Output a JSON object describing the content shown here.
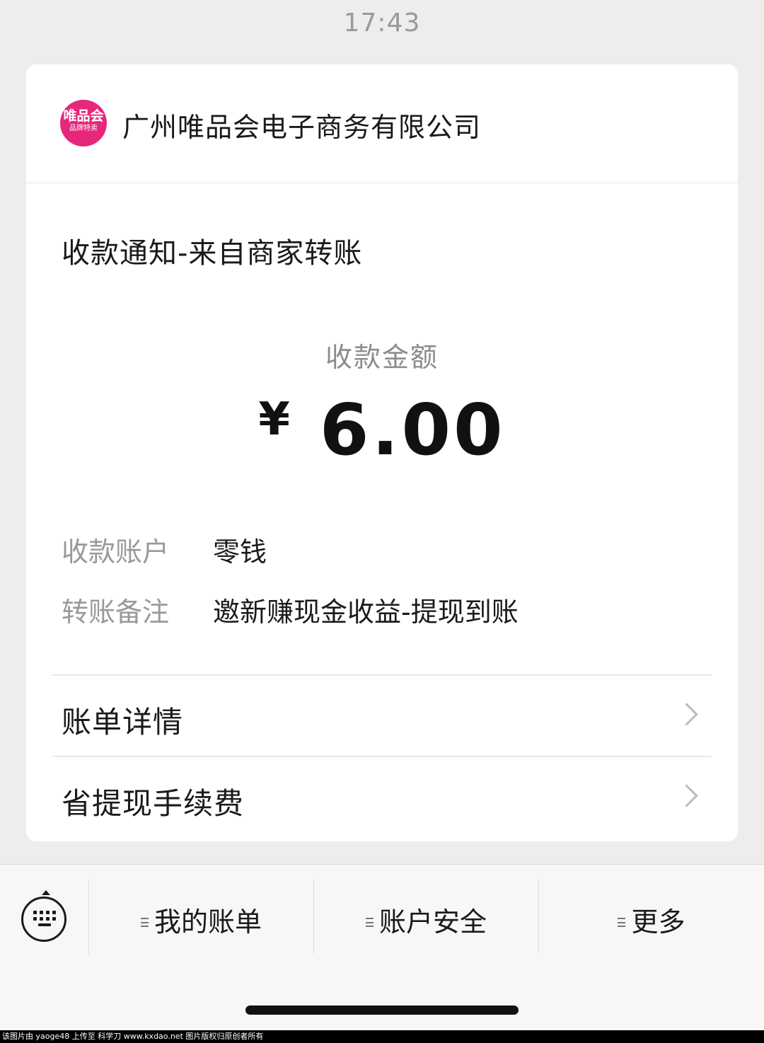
{
  "status_bar": {
    "time": "17:43"
  },
  "merchant": {
    "logo_text": "唯品会",
    "logo_subtext": "品牌特卖",
    "name": "广州唯品会电子商务有限公司"
  },
  "notice": {
    "title": "收款通知-来自商家转账",
    "amount_label": "收款金额",
    "currency_symbol": "¥",
    "amount": "6.00",
    "details": [
      {
        "label": "收款账户",
        "value": "零钱"
      },
      {
        "label": "转账备注",
        "value": "邀新赚现金收益-提现到账"
      }
    ]
  },
  "menu": [
    {
      "label": "账单详情"
    },
    {
      "label": "省提现手续费"
    }
  ],
  "bottom_bar": {
    "tabs": [
      {
        "label": "我的账单"
      },
      {
        "label": "账户安全"
      },
      {
        "label": "更多"
      }
    ]
  },
  "watermark": "该图片由 yaoge48 上传至 科学刀 www.kxdao.net 图片版权归原创者所有",
  "colors": {
    "page_background": "#ededed",
    "card_background": "#ffffff",
    "logo_pink": "#e6287a",
    "secondary_text": "#999999"
  }
}
